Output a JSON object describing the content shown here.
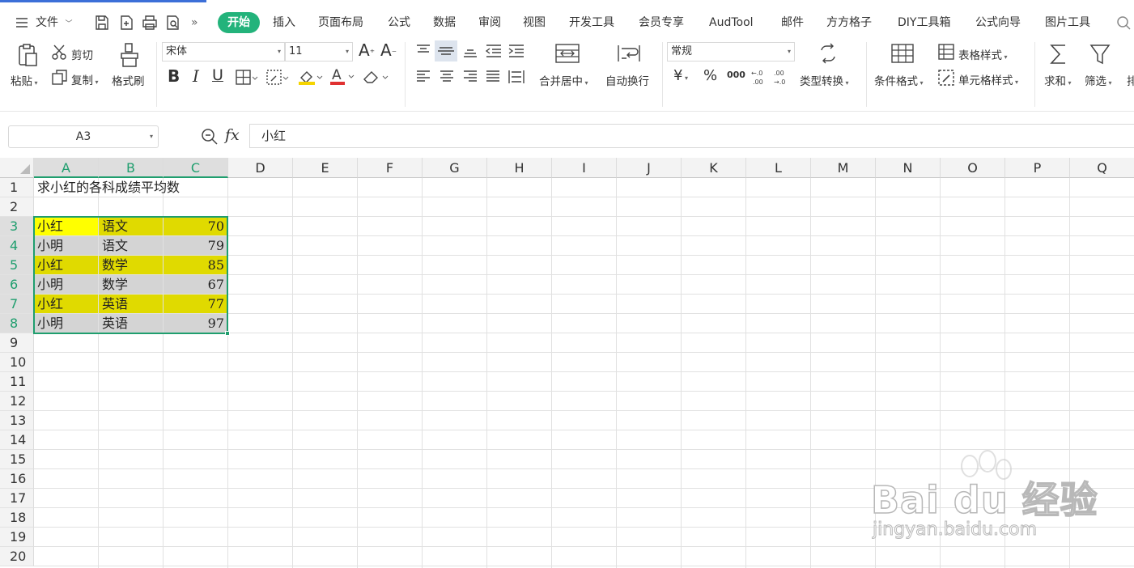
{
  "menubar": {
    "file_label": "文件",
    "more_label": "»",
    "tabs": [
      "开始",
      "插入",
      "页面布局",
      "公式",
      "数据",
      "审阅",
      "视图",
      "开发工具",
      "会员专享",
      "AudTool",
      "邮件",
      "方方格子",
      "DIY工具箱",
      "公式向导",
      "图片工具"
    ],
    "active_tab": "开始"
  },
  "ribbon": {
    "paste": "粘贴",
    "cut": "剪切",
    "copy": "复制",
    "format_painter": "格式刷",
    "font_name": "宋体",
    "font_size": "11",
    "merge_center": "合并居中",
    "wrap_text": "自动换行",
    "number_format": "常规",
    "currency_symbol": "¥",
    "percent_symbol": "%",
    "thousands": "000",
    "type_convert": "类型转换",
    "conditional_format": "条件格式",
    "table_style": "表格样式",
    "cell_style": "单元格样式",
    "sum": "求和",
    "filter": "筛选",
    "sort": "排"
  },
  "formula_bar": {
    "name_box": "A3",
    "fx": "fx",
    "content": "小红"
  },
  "sheet": {
    "columns": [
      "A",
      "B",
      "C",
      "D",
      "E",
      "F",
      "G",
      "H",
      "I",
      "J",
      "K",
      "L",
      "M",
      "N",
      "O",
      "P",
      "Q"
    ],
    "selected_columns": [
      "A",
      "B",
      "C"
    ],
    "rows": [
      "1",
      "2",
      "3",
      "4",
      "5",
      "6",
      "7",
      "8",
      "9",
      "10",
      "11",
      "12",
      "13",
      "14",
      "15",
      "16",
      "17",
      "18",
      "19",
      "20"
    ],
    "selected_rows": [
      "3",
      "4",
      "5",
      "6",
      "7",
      "8"
    ],
    "title_cell": "求小红的各科成绩平均数",
    "data": [
      {
        "name": "小红",
        "subject": "语文",
        "score": "70",
        "highlight": "#e0da00"
      },
      {
        "name": "小明",
        "subject": "语文",
        "score": "79",
        "highlight": "#d4d4d4"
      },
      {
        "name": "小红",
        "subject": "数学",
        "score": "85",
        "highlight": "#e0da00"
      },
      {
        "name": "小明",
        "subject": "数学",
        "score": "67",
        "highlight": "#d4d4d4"
      },
      {
        "name": "小红",
        "subject": "英语",
        "score": "77",
        "highlight": "#e0da00"
      },
      {
        "name": "小明",
        "subject": "英语",
        "score": "97",
        "highlight": "#d4d4d4"
      }
    ],
    "active_cell_color": "#ffff00",
    "selection_color": "#1f9e6e"
  },
  "watermark": {
    "brand": "Bai du 经验",
    "url": "jingyan.baidu.com"
  }
}
